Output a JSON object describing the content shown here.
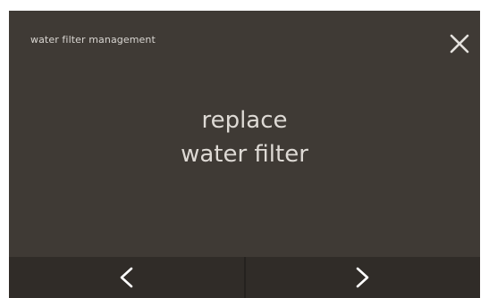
{
  "header": {
    "title": "water filter management",
    "close_icon": "close-icon"
  },
  "message": {
    "line1": "replace",
    "line2": "water filter"
  },
  "navigation": {
    "prev_icon": "chevron-left-icon",
    "next_icon": "chevron-right-icon"
  },
  "colors": {
    "background": "#3f3a35",
    "navbar": "#302c28",
    "text": "#dedad5"
  }
}
